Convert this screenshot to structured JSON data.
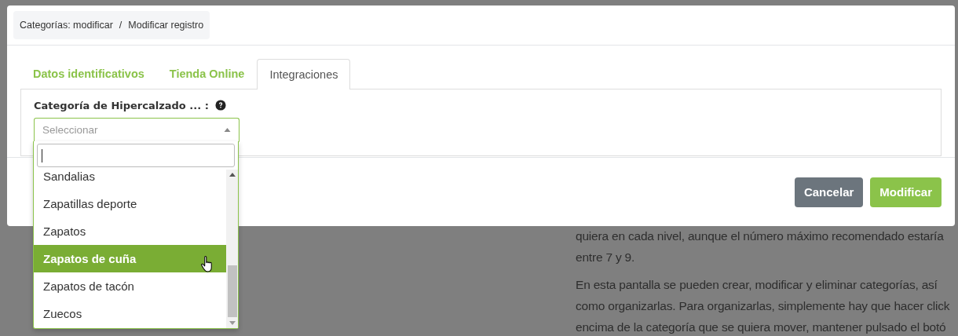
{
  "help_text": {
    "paragraphs": [
      [
        "quiera en cada nivel, aunque el número máximo recomendado estaría",
        "entre 7 y 9."
      ],
      [
        "En esta pantalla se pueden crear, modificar y eliminar categorías, así",
        "como organizarlas. Para organizarlas, simplemente hay que hacer click",
        "encima de la categoría que se quiera mover, mantener pulsado el botó"
      ]
    ]
  },
  "modal": {
    "breadcrumb_separator": "/",
    "breadcrumb": [
      "Categorías: modificar",
      "Modificar registro"
    ],
    "tabs": [
      {
        "label": "Datos identificativos",
        "selected": false
      },
      {
        "label": "Tienda Online",
        "selected": false
      },
      {
        "label": "Integraciones",
        "selected": true
      }
    ],
    "field": {
      "label": "Categoría de Hipercalzado ... :",
      "placeholder": "Seleccionar",
      "expanded": true
    },
    "options": [
      {
        "label": "Sandalias",
        "selected": false
      },
      {
        "label": "Zapatillas deporte",
        "selected": false
      },
      {
        "label": "Zapatos",
        "selected": false
      },
      {
        "label": "Zapatos de cuña",
        "selected": true
      },
      {
        "label": "Zapatos de tacón",
        "selected": false
      },
      {
        "label": "Zuecos",
        "selected": false
      }
    ],
    "buttons": [
      {
        "label": "Cancelar",
        "kind": "secondary"
      },
      {
        "label": "Modificar",
        "kind": "primary"
      }
    ]
  }
}
